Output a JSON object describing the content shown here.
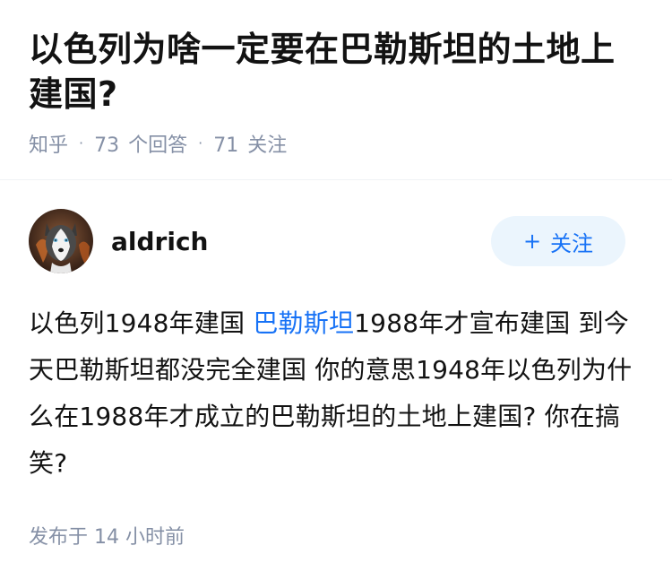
{
  "question": {
    "title": "以色列为啥一定要在巴勒斯坦的土地上建国?",
    "source": "知乎",
    "answer_count": "73",
    "answer_label": "个回答",
    "follower_count": "71",
    "follower_label": "关注"
  },
  "answer": {
    "author": {
      "name": "aldrich",
      "avatar_icon": "husky-avatar"
    },
    "follow_button": {
      "icon": "plus-icon",
      "label": "关注"
    },
    "content": {
      "part1": "以色列1948年建国 ",
      "link": "巴勒斯坦",
      "part2": "1988年才宣布建国 到今天巴勒斯坦都没完全建国 你的意思1948年以色列为什么在1988年才成立的巴勒斯坦的土地上建国? 你在搞笑?"
    },
    "publish": {
      "label": "发布于",
      "time": "14 小时前"
    }
  },
  "colors": {
    "text": "#121212",
    "muted": "#8590a6",
    "link": "#1772f6",
    "button_bg": "#ebf5fd"
  }
}
